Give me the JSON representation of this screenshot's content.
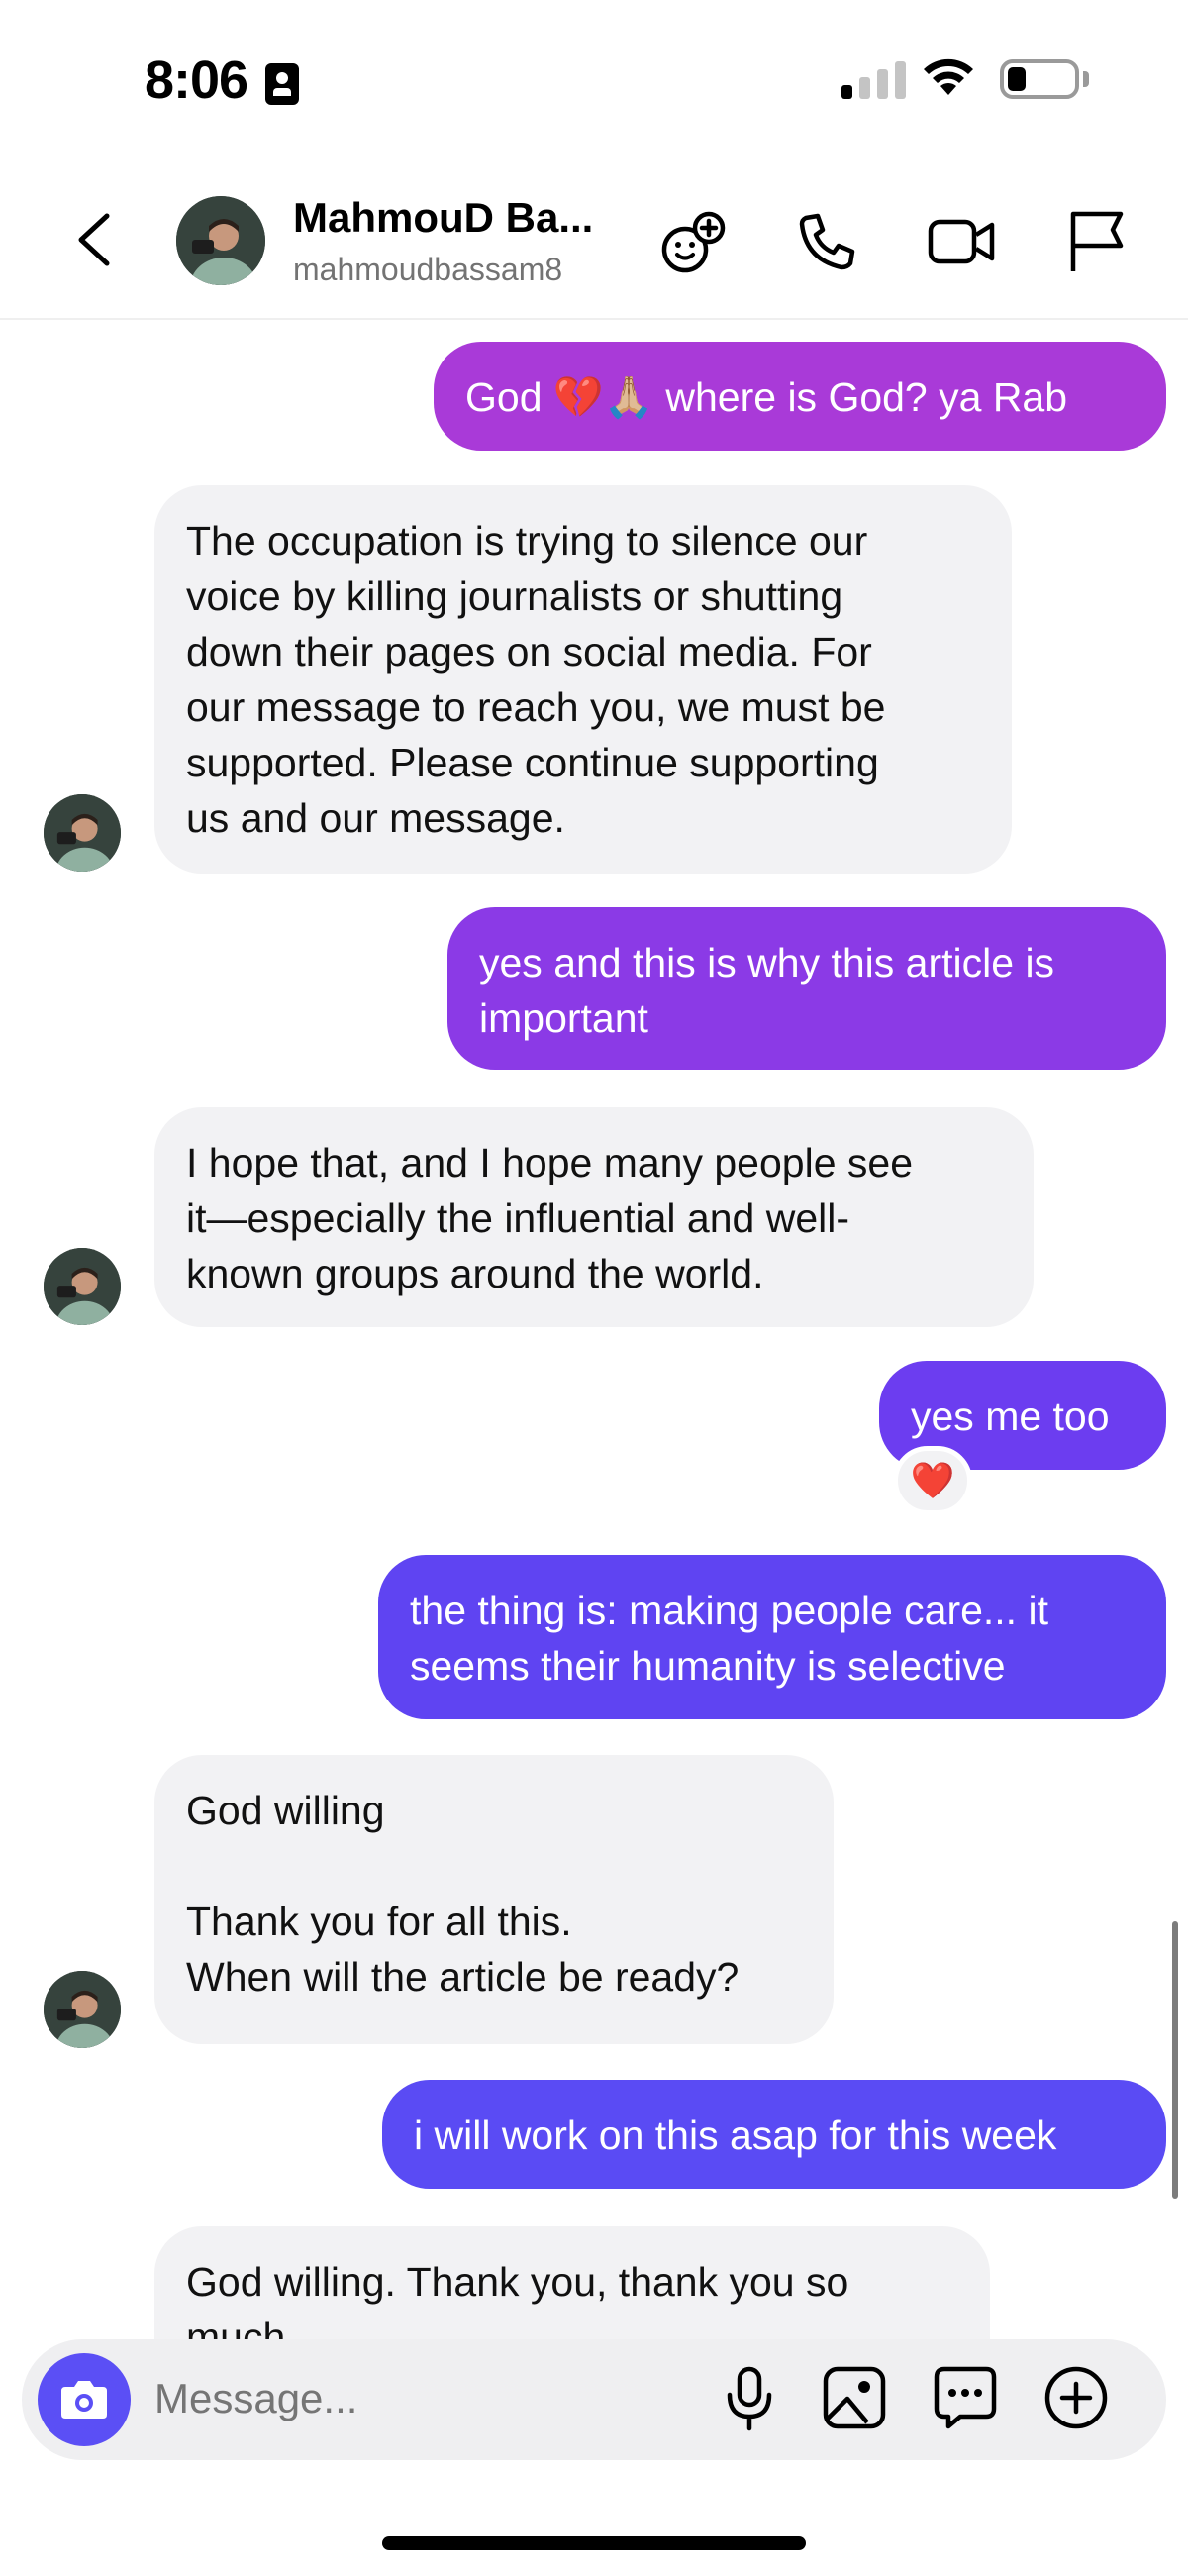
{
  "status_bar": {
    "time": "8:06",
    "battery_level": 0.2,
    "signal_bars": 1
  },
  "header": {
    "contact_name": "MahmouD Ba...",
    "contact_handle": "mahmoudbassam8",
    "icons": [
      "back-chevron-icon",
      "effects-icon",
      "phone-icon",
      "video-icon",
      "flag-icon"
    ]
  },
  "messages": [
    {
      "side": "out",
      "text": "God 💔🙏🏼 where is God? ya Rab",
      "color": "#a93ad8"
    },
    {
      "side": "in",
      "text": "The occupation is trying to silence our\nvoice by killing journalists or shutting\ndown their pages on social media. For\nour message to reach you, we must be\nsupported. Please continue supporting\nus and our message."
    },
    {
      "side": "out",
      "text": "yes and this is why this article is\nimportant",
      "color": "#8b3ae6"
    },
    {
      "side": "in",
      "text": "I hope that, and I hope many people see\nit—especially the influential and well-\nknown groups around the world."
    },
    {
      "side": "out",
      "text": "yes me too",
      "color": "#6c3df0",
      "reaction": "❤️"
    },
    {
      "side": "out",
      "text": "the thing is: making people care... it\nseems their humanity is selective",
      "color": "#5f44f2"
    },
    {
      "side": "in",
      "text": "God willing\n\nThank you for all this.\nWhen will the article be ready?"
    },
    {
      "side": "out",
      "text": "i will work on this asap for this week",
      "color": "#5a4bf4"
    },
    {
      "side": "in",
      "text": "God willing. Thank you, thank you so\nmuch"
    }
  ],
  "composer": {
    "placeholder": "Message...",
    "icons": [
      "camera-icon",
      "microphone-icon",
      "gallery-icon",
      "sticker-icon",
      "add-icon"
    ]
  }
}
